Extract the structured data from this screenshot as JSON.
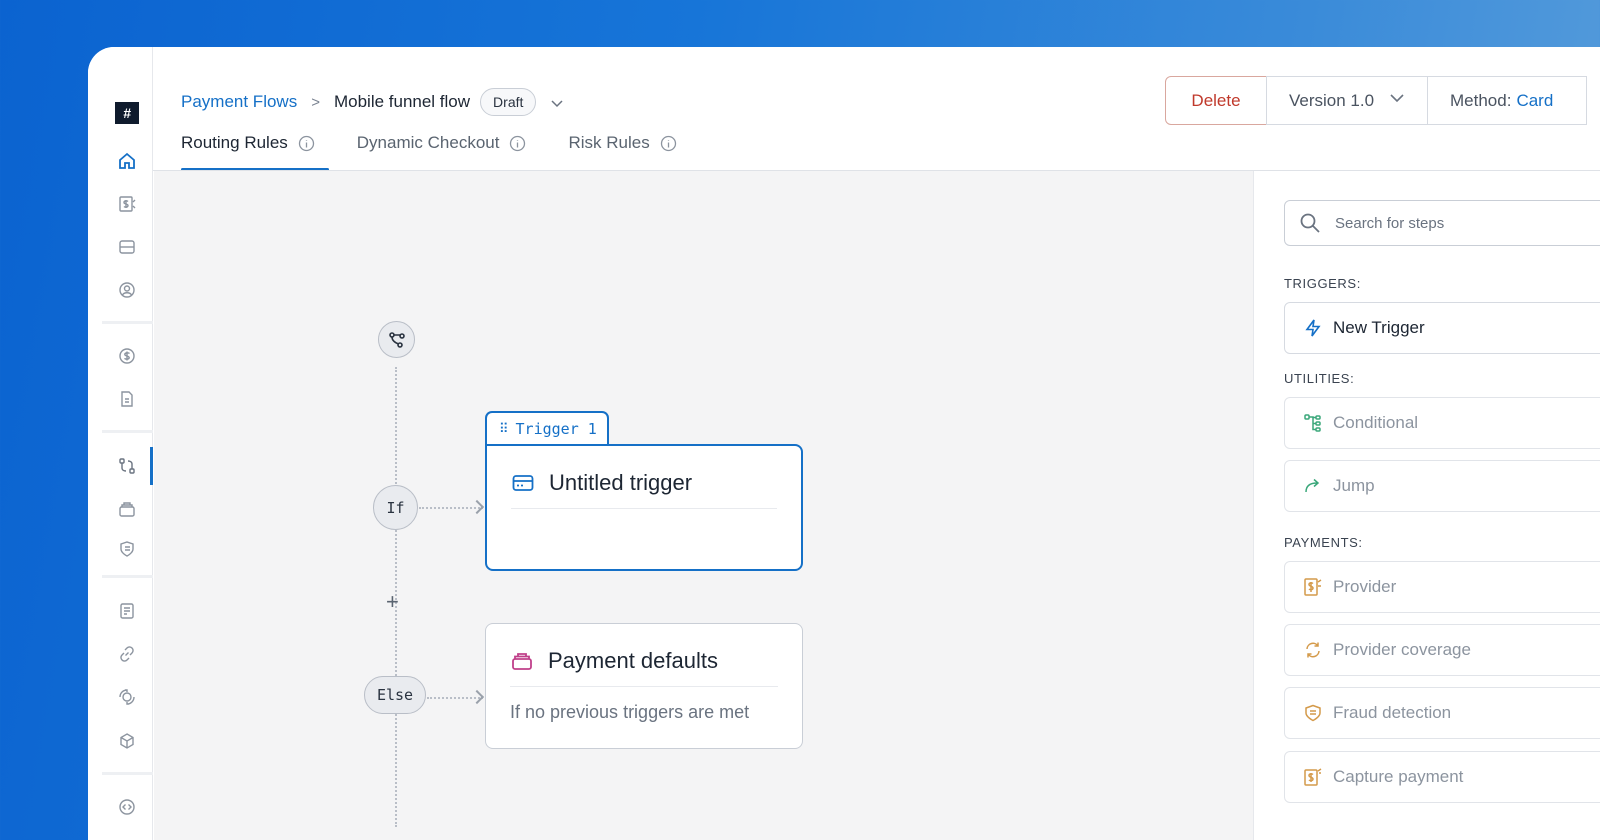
{
  "app": {
    "logo_text": "#"
  },
  "header": {
    "breadcrumb_root": "Payment Flows",
    "breadcrumb_separator": ">",
    "flow_name": "Mobile funnel flow",
    "status_badge": "Draft",
    "delete_label": "Delete",
    "version_label": "Version 1.0",
    "method_label": "Method:",
    "method_value": "Card"
  },
  "tabs": [
    {
      "label": "Routing Rules",
      "active": true
    },
    {
      "label": "Dynamic Checkout",
      "active": false
    },
    {
      "label": "Risk Rules",
      "active": false
    }
  ],
  "canvas": {
    "if_label": "If",
    "else_label": "Else",
    "plus_label": "+",
    "trigger_tab_label": "Trigger 1",
    "trigger_card_title": "Untitled trigger",
    "defaults_card_title": "Payment defaults",
    "defaults_card_subtitle": "If no previous triggers are met"
  },
  "panel": {
    "search_placeholder": "Search for steps",
    "sections": {
      "triggers": "TRIGGERS:",
      "utilities": "UTILITIES:",
      "payments": "PAYMENTS:"
    },
    "triggers": [
      {
        "label": "New Trigger",
        "icon": "lightning-icon"
      }
    ],
    "utilities": [
      {
        "label": "Conditional",
        "icon": "conditional-icon"
      },
      {
        "label": "Jump",
        "icon": "jump-arrow-icon"
      }
    ],
    "payments": [
      {
        "label": "Provider",
        "icon": "provider-icon"
      },
      {
        "label": "Provider coverage",
        "icon": "refresh-icon"
      },
      {
        "label": "Fraud detection",
        "icon": "shield-icon"
      },
      {
        "label": "Capture payment",
        "icon": "capture-icon"
      }
    ]
  },
  "colors": {
    "accent": "#1570c7",
    "danger": "#c0392b",
    "defaults_icon": "#c0408a",
    "utility_icon": "#3aa77a",
    "payment_icon": "#d49a4a"
  }
}
